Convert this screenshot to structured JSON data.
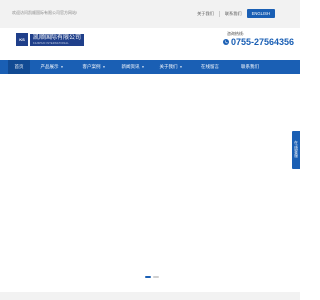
{
  "topbar": {
    "welcome": "欢迎访问凯顺国际有限公司官方网站!",
    "links": [
      "关于我们",
      "联系我们"
    ],
    "english_button": "ENGLISH"
  },
  "header": {
    "logo_mark": "KS",
    "logo_cn": "凯顺国际有限公司",
    "logo_en": "KAISHUN INTERNATIONAL",
    "hotline_label": "咨询热线:",
    "hotline_number": "0755-27564356"
  },
  "nav": {
    "items": [
      {
        "label": "首页",
        "dropdown": false
      },
      {
        "label": "产品展示",
        "dropdown": true
      },
      {
        "label": "客户案例",
        "dropdown": true
      },
      {
        "label": "新闻资讯",
        "dropdown": true
      },
      {
        "label": "关于我们",
        "dropdown": true
      },
      {
        "label": "在线留言",
        "dropdown": false
      },
      {
        "label": "联系我们",
        "dropdown": false
      }
    ]
  },
  "banner": {
    "slide_count": 2,
    "active_slide": 1
  },
  "side_float": {
    "label": "在线客服"
  },
  "colors": {
    "primary": "#1a5fb4",
    "nav_active": "#114a93",
    "logo": "#1f3f8a"
  }
}
